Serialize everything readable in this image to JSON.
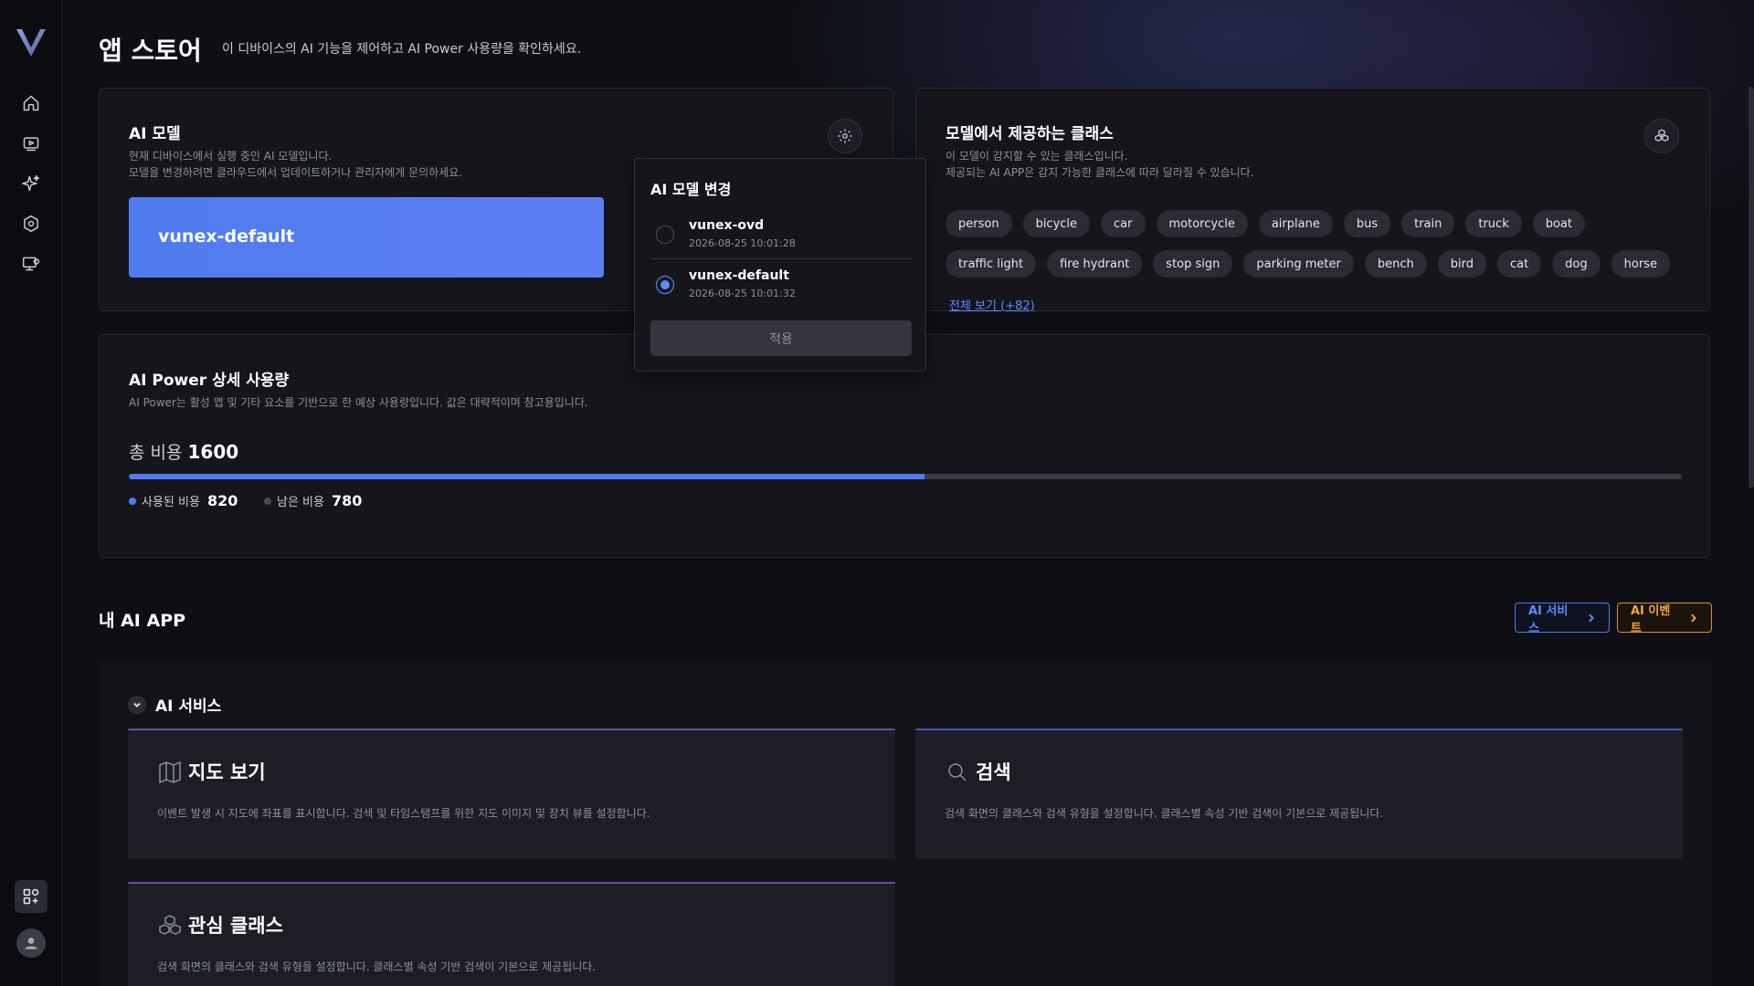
{
  "header": {
    "title": "앱 스토어",
    "description": "이 디바이스의 AI 기능을 제어하고 AI Power 사용량을 확인하세요."
  },
  "sidebar": {
    "items": [
      {
        "icon": "home-icon"
      },
      {
        "icon": "video-icon"
      },
      {
        "icon": "sparkle-icon"
      },
      {
        "icon": "settings-icon"
      },
      {
        "icon": "monitor-settings-icon"
      }
    ]
  },
  "ai_model": {
    "title": "AI 모델",
    "sub1": "현재 디바이스에서 실행 중인 AI 모델입니다.",
    "sub2": "모델을 변경하려면 클라우드에서 업데이트하거나 관리자에게 문의하세요.",
    "current": "vunex-default"
  },
  "model_dropdown": {
    "title": "AI 모델 변경",
    "options": [
      {
        "name": "vunex-ovd",
        "time": "2026-08-25 10:01:28",
        "selected": false
      },
      {
        "name": "vunex-default",
        "time": "2026-08-25 10:01:32",
        "selected": true
      }
    ],
    "apply_label": "적용"
  },
  "classes": {
    "title": "모델에서 제공하는 클래스",
    "sub1": "이 모델이 감지할 수 있는 클래스입니다.",
    "sub2": "제공되는 AI APP은 감지 가능한 클래스에 따라 달라질 수 있습니다.",
    "items": [
      "person",
      "bicycle",
      "car",
      "motorcycle",
      "airplane",
      "bus",
      "train",
      "truck",
      "boat",
      "traffic light",
      "fire hydrant",
      "stop sign",
      "parking meter",
      "bench",
      "bird",
      "cat",
      "dog",
      "horse"
    ],
    "more_label": "전체 보기 (+82)"
  },
  "power": {
    "title": "AI Power 상세 사용량",
    "sub": "AI Power는 활성 앱 및 기타 요소를 기반으로 한 예상 사용량입니다. 값은 대략적이며 참고용입니다.",
    "total_label": "총 비용",
    "total": "1600",
    "used_label": "사용된 비용",
    "used": "820",
    "remaining_label": "남은 비용",
    "remaining": "780",
    "used_fraction": 0.5125,
    "used_color": "#4e7cf0"
  },
  "my_apps": {
    "title": "내 AI APP",
    "service_btn": "AI 서비스",
    "event_btn": "AI 이벤트",
    "group_title": "AI 서비스",
    "cards": [
      {
        "title": "지도 보기",
        "icon": "map-icon",
        "desc": "이벤트 발생 시 지도에 좌표를 표시합니다. 검색 및 타임스탬프를 위한 지도 이미지 및 장치 뷰를 설정합니다."
      },
      {
        "title": "검색",
        "icon": "search-icon",
        "desc": "검색 화면의 클래스와 검색 유형을 설정합니다. 클래스별 속성 기반 검색이 기본으로 제공됩니다."
      },
      {
        "title": "관심 클래스",
        "icon": "cubes-icon",
        "desc": "검색 화면의 클래스와 검색 유형을 설정합니다. 클래스별 속성 기반 검색이 기본으로 제공됩니다."
      }
    ]
  }
}
